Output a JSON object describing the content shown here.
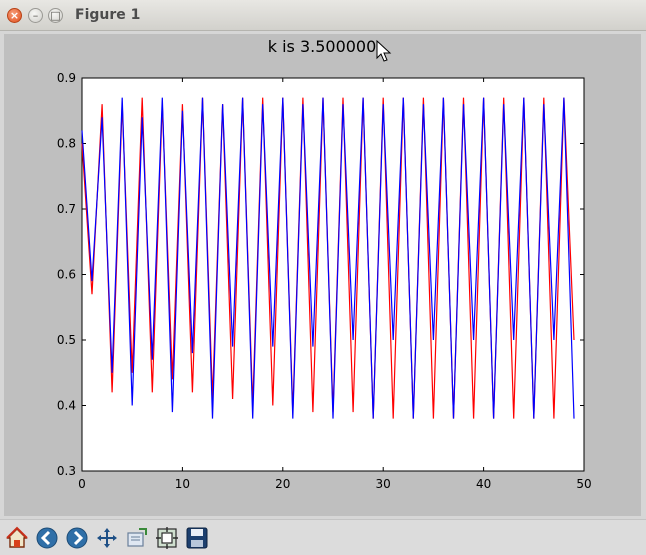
{
  "window": {
    "title": "Figure 1"
  },
  "toolbar": {
    "buttons": [
      {
        "name": "home-button",
        "icon": "home-icon"
      },
      {
        "name": "back-button",
        "icon": "left-arrow-icon"
      },
      {
        "name": "forward-button",
        "icon": "right-arrow-icon"
      },
      {
        "name": "pan-button",
        "icon": "move-icon"
      },
      {
        "name": "zoom-button",
        "icon": "zoom-rect-icon"
      },
      {
        "name": "subplots-button",
        "icon": "subplots-icon"
      },
      {
        "name": "save-button",
        "icon": "save-icon"
      }
    ]
  },
  "chart_data": {
    "type": "line",
    "title": "k is 3.500000",
    "xlabel": "",
    "ylabel": "",
    "xlim": [
      0,
      50
    ],
    "ylim": [
      0.3,
      0.9
    ],
    "xticks": [
      "0",
      "10",
      "20",
      "30",
      "40",
      "50"
    ],
    "yticks": [
      "0.3",
      "0.4",
      "0.5",
      "0.6",
      "0.7",
      "0.8",
      "0.9"
    ],
    "grid": false,
    "series": [
      {
        "color": "#ff0000",
        "x": [
          0,
          1,
          2,
          3,
          4,
          5,
          6,
          7,
          8,
          9,
          10,
          11,
          12,
          13,
          14,
          15,
          16,
          17,
          18,
          19,
          20,
          21,
          22,
          23,
          24,
          25,
          26,
          27,
          28,
          29,
          30,
          31,
          32,
          33,
          34,
          35,
          36,
          37,
          38,
          39,
          40,
          41,
          42,
          43,
          44,
          45,
          46,
          47,
          48,
          49
        ],
        "y": [
          0.8,
          0.57,
          0.86,
          0.42,
          0.86,
          0.45,
          0.87,
          0.42,
          0.86,
          0.44,
          0.86,
          0.42,
          0.87,
          0.41,
          0.86,
          0.41,
          0.87,
          0.4,
          0.87,
          0.4,
          0.87,
          0.39,
          0.87,
          0.39,
          0.87,
          0.39,
          0.87,
          0.39,
          0.87,
          0.38,
          0.87,
          0.38,
          0.87,
          0.38,
          0.87,
          0.38,
          0.87,
          0.38,
          0.87,
          0.38,
          0.87,
          0.38,
          0.87,
          0.38,
          0.87,
          0.38,
          0.87,
          0.38,
          0.87,
          0.5
        ]
      },
      {
        "color": "#0000ff",
        "x": [
          0,
          1,
          2,
          3,
          4,
          5,
          6,
          7,
          8,
          9,
          10,
          11,
          12,
          13,
          14,
          15,
          16,
          17,
          18,
          19,
          20,
          21,
          22,
          23,
          24,
          25,
          26,
          27,
          28,
          29,
          30,
          31,
          32,
          33,
          34,
          35,
          36,
          37,
          38,
          39,
          40,
          41,
          42,
          43,
          44,
          45,
          46,
          47,
          48,
          49
        ],
        "y": [
          0.82,
          0.59,
          0.84,
          0.45,
          0.87,
          0.4,
          0.84,
          0.47,
          0.87,
          0.39,
          0.85,
          0.48,
          0.87,
          0.38,
          0.86,
          0.49,
          0.87,
          0.38,
          0.86,
          0.49,
          0.87,
          0.38,
          0.86,
          0.49,
          0.87,
          0.38,
          0.86,
          0.5,
          0.87,
          0.38,
          0.86,
          0.5,
          0.87,
          0.38,
          0.86,
          0.5,
          0.87,
          0.38,
          0.86,
          0.5,
          0.87,
          0.38,
          0.86,
          0.5,
          0.87,
          0.38,
          0.86,
          0.5,
          0.87,
          0.38
        ]
      }
    ]
  }
}
